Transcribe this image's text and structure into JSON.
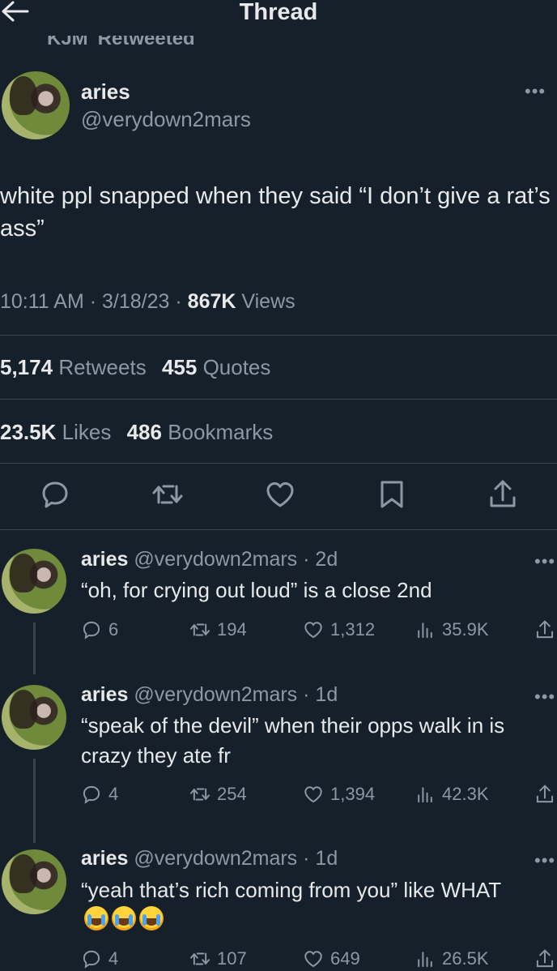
{
  "header": {
    "title": "Thread"
  },
  "retweet_bar": {
    "who": "KJM",
    "label": "Retweeted"
  },
  "main_tweet": {
    "name": "aries",
    "handle": "@verydown2mars",
    "text": "white ppl snapped when they said “I don’t give a rat’s ass”",
    "time": "10:11 AM",
    "date": "3/18/23",
    "views_count": "867K",
    "views_label": "Views",
    "sep": "·",
    "retweets_count": "5,174",
    "retweets_label": "Retweets",
    "quotes_count": "455",
    "quotes_label": "Quotes",
    "likes_count": "23.5K",
    "likes_label": "Likes",
    "bookmarks_count": "486",
    "bookmarks_label": "Bookmarks"
  },
  "replies": [
    {
      "name": "aries",
      "handle": "@verydown2mars",
      "age": "2d",
      "text": "“oh, for crying out loud” is a close 2nd",
      "replies": "6",
      "retweets": "194",
      "likes": "1,312",
      "views": "35.9K"
    },
    {
      "name": "aries",
      "handle": "@verydown2mars",
      "age": "1d",
      "text": "“speak of the devil” when their opps walk in is crazy they ate fr",
      "replies": "4",
      "retweets": "254",
      "likes": "1,394",
      "views": "42.3K"
    },
    {
      "name": "aries",
      "handle": "@verydown2mars",
      "age": "1d",
      "text": "“yeah that’s rich coming from you” like WHAT",
      "replies": "4",
      "retweets": "107",
      "likes": "649",
      "views": "26.5K"
    }
  ],
  "icons": {
    "back": "arrow-left-icon",
    "more": "more-dots-icon",
    "reply": "reply-icon",
    "retweet": "retweet-icon",
    "like": "heart-icon",
    "bookmark": "bookmark-icon",
    "share": "share-icon",
    "views": "views-bar-icon",
    "emoji": "loudly-crying-face-emoji"
  },
  "colors": {
    "background": "#15202b",
    "text": "#e7e9ea",
    "muted": "#8b98a5",
    "divider": "#38444d"
  }
}
